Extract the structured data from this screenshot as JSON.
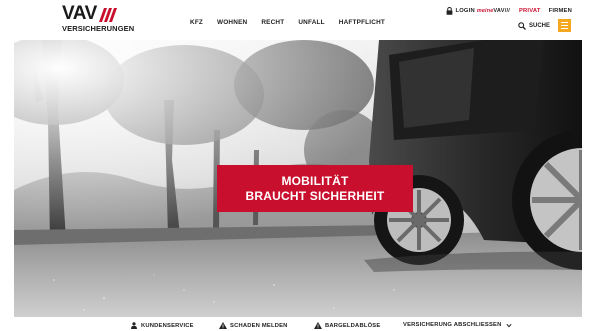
{
  "brand": {
    "name": "VAV",
    "subtitle": "VERSICHERUNGEN",
    "accent_color": "#c8102e",
    "menu_color": "#f4a81f"
  },
  "topbar": {
    "login_label": "LOGIN",
    "login_brand_prefix": "meine",
    "login_brand": "VAV///",
    "segment_privat": "PRIVAT",
    "segment_firmen": "FIRMEN"
  },
  "nav": {
    "items": [
      "KFZ",
      "WOHNEN",
      "RECHT",
      "UNFALL",
      "HAFTPFLICHT"
    ]
  },
  "search": {
    "label": "SUCHE"
  },
  "hero": {
    "line1": "MOBILITÄT",
    "line2": "BRAUCHT SICHERHEIT"
  },
  "bottombar": {
    "items": [
      {
        "label": "KUNDENSERVICE",
        "icon": "person-icon"
      },
      {
        "label": "SCHADEN MELDEN",
        "icon": "warning-icon"
      },
      {
        "label": "BARGELDABLÖSE",
        "icon": "warning-icon"
      },
      {
        "label": "VERSICHERUNG ABSCHLIESSEN",
        "icon": "chevron-down-icon"
      }
    ]
  }
}
